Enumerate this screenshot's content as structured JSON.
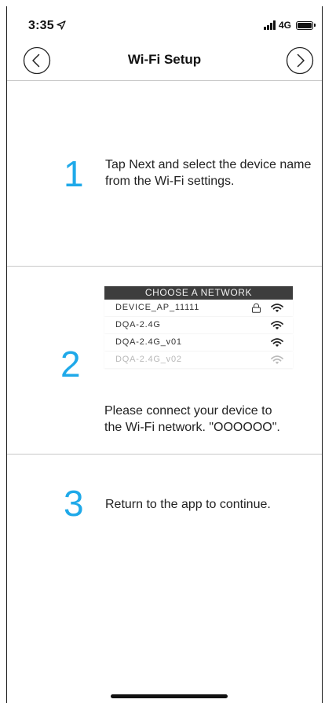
{
  "status_bar": {
    "time": "3:35",
    "network": "4G",
    "icons": [
      "location-arrow-icon",
      "signal-bars-icon",
      "battery-icon"
    ]
  },
  "nav": {
    "title": "Wi-Fi Setup",
    "back_icon": "chevron-left-circle-icon",
    "next_icon": "chevron-right-circle-icon"
  },
  "steps": [
    {
      "number": "1",
      "text": "Tap Next and select the device name from the Wi-Fi settings."
    },
    {
      "number": "2",
      "text": "Please connect your device to the Wi-Fi network. \"OOOOOO\"."
    },
    {
      "number": "3",
      "text": "Return to the app to continue."
    }
  ],
  "network_list": {
    "header": "CHOOSE A NETWORK",
    "items": [
      {
        "name": "DEVICE_AP_11111",
        "locked": true,
        "faded": false
      },
      {
        "name": "DQA-2.4G",
        "locked": false,
        "faded": false
      },
      {
        "name": "DQA-2.4G_v01",
        "locked": false,
        "faded": false
      },
      {
        "name": "DQA-2.4G_v02",
        "locked": false,
        "faded": true
      }
    ]
  },
  "colors": {
    "accent": "#1fa9e9",
    "divider": "#c8c8c8",
    "list_header": "#3d3d3d"
  }
}
